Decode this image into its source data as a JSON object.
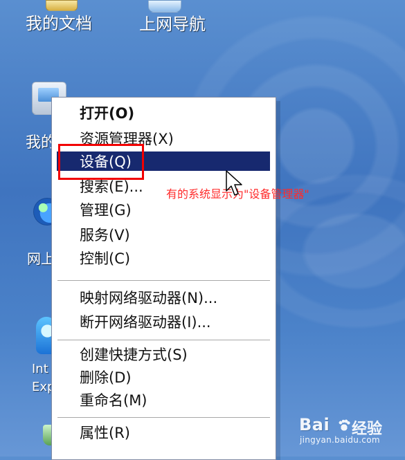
{
  "desktop": {
    "top_icons": [
      {
        "label": "我的文档"
      },
      {
        "label": "上网导航"
      }
    ],
    "side_labels": {
      "computer_partial": "我的",
      "network_partial": "网上",
      "ie_partial_line1": "Int",
      "ie_partial_line2": "Exp"
    }
  },
  "context_menu": {
    "items": [
      {
        "label": "打开(O)"
      },
      {
        "label": "资源管理器(X)"
      },
      {
        "label": "设备(Q)"
      },
      {
        "label": "搜索(E)..."
      },
      {
        "label": "管理(G)"
      },
      {
        "label": "服务(V)"
      },
      {
        "label": "控制(C)"
      },
      {
        "label": "映射网络驱动器(N)..."
      },
      {
        "label": "断开网络驱动器(I)..."
      },
      {
        "label": "创建快捷方式(S)"
      },
      {
        "label": "删除(D)"
      },
      {
        "label": "重命名(M)"
      },
      {
        "label": "属性(R)"
      }
    ]
  },
  "annotation": {
    "text": "有的系统显示为\"设备管理器\""
  },
  "watermark": {
    "logo_text": "Bai",
    "cn_text": "经验",
    "url": "jingyan.baidu.com"
  },
  "colors": {
    "highlight": "#17296f",
    "annotation": "#ff2b2b"
  }
}
